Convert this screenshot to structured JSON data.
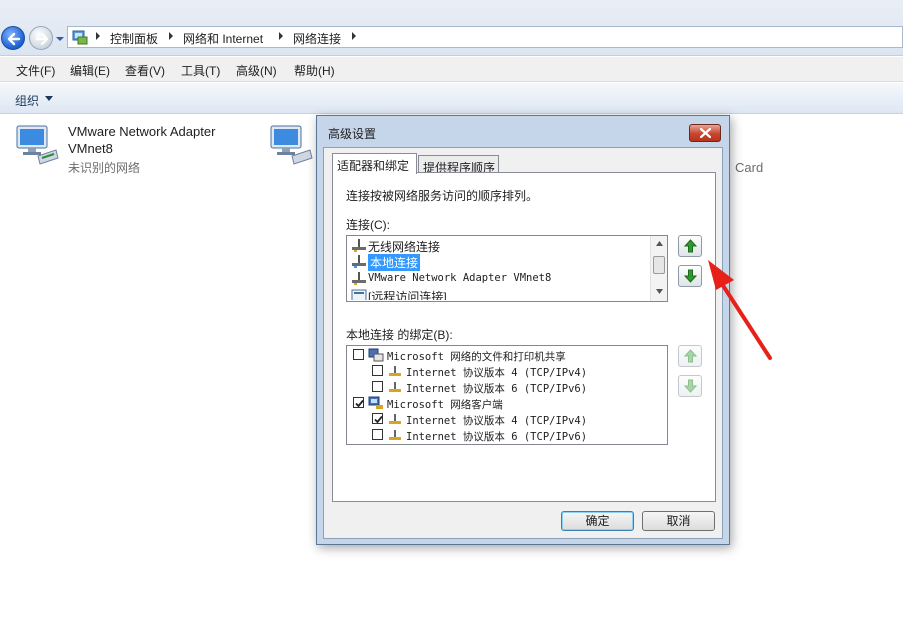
{
  "breadcrumb": [
    "控制面板",
    "网络和 Internet",
    "网络连接"
  ],
  "menu": [
    "文件(F)",
    "编辑(E)",
    "查看(V)",
    "工具(T)",
    "高级(N)",
    "帮助(H)"
  ],
  "toolbar": {
    "organize_label": "组织"
  },
  "adapters": [
    {
      "name_line1": "VMware Network Adapter",
      "name_line2": "VMnet8",
      "status": "未识别的网络"
    },
    {
      "partial_label": "Card"
    }
  ],
  "dialog": {
    "title": "高级设置",
    "tabs": [
      "适配器和绑定",
      "提供程序顺序"
    ],
    "description": "连接按被网络服务访问的顺序排列。",
    "connections_label": "连接(C):",
    "connections": [
      "无线网络连接",
      "本地连接",
      "VMware Network Adapter VMnet8",
      "[远程访问连接]"
    ],
    "selected_connection": "本地连接",
    "bindings_label": "本地连接 的绑定(B):",
    "bindings": [
      {
        "label": "Microsoft 网络的文件和打印机共享",
        "checked": false,
        "level": 0
      },
      {
        "label": "Internet 协议版本 4 (TCP/IPv4)",
        "checked": false,
        "level": 1
      },
      {
        "label": "Internet 协议版本 6 (TCP/IPv6)",
        "checked": false,
        "level": 1
      },
      {
        "label": "Microsoft 网络客户端",
        "checked": true,
        "level": 0
      },
      {
        "label": "Internet 协议版本 4 (TCP/IPv4)",
        "checked": true,
        "level": 1
      },
      {
        "label": "Internet 协议版本 6 (TCP/IPv6)",
        "checked": false,
        "level": 1
      }
    ],
    "ok_label": "确定",
    "cancel_label": "取消"
  },
  "colors": {
    "selection": "#3399ff",
    "annotation_arrow": "#e8201a",
    "move_arrow_green": "#2e9b2e"
  },
  "icons": [
    "back-arrow-icon",
    "forward-arrow-icon",
    "control-panel-icon",
    "network-adapter-icon",
    "close-icon",
    "move-up-icon",
    "move-down-icon",
    "network-connection-icon",
    "service-icon",
    "protocol-icon"
  ]
}
